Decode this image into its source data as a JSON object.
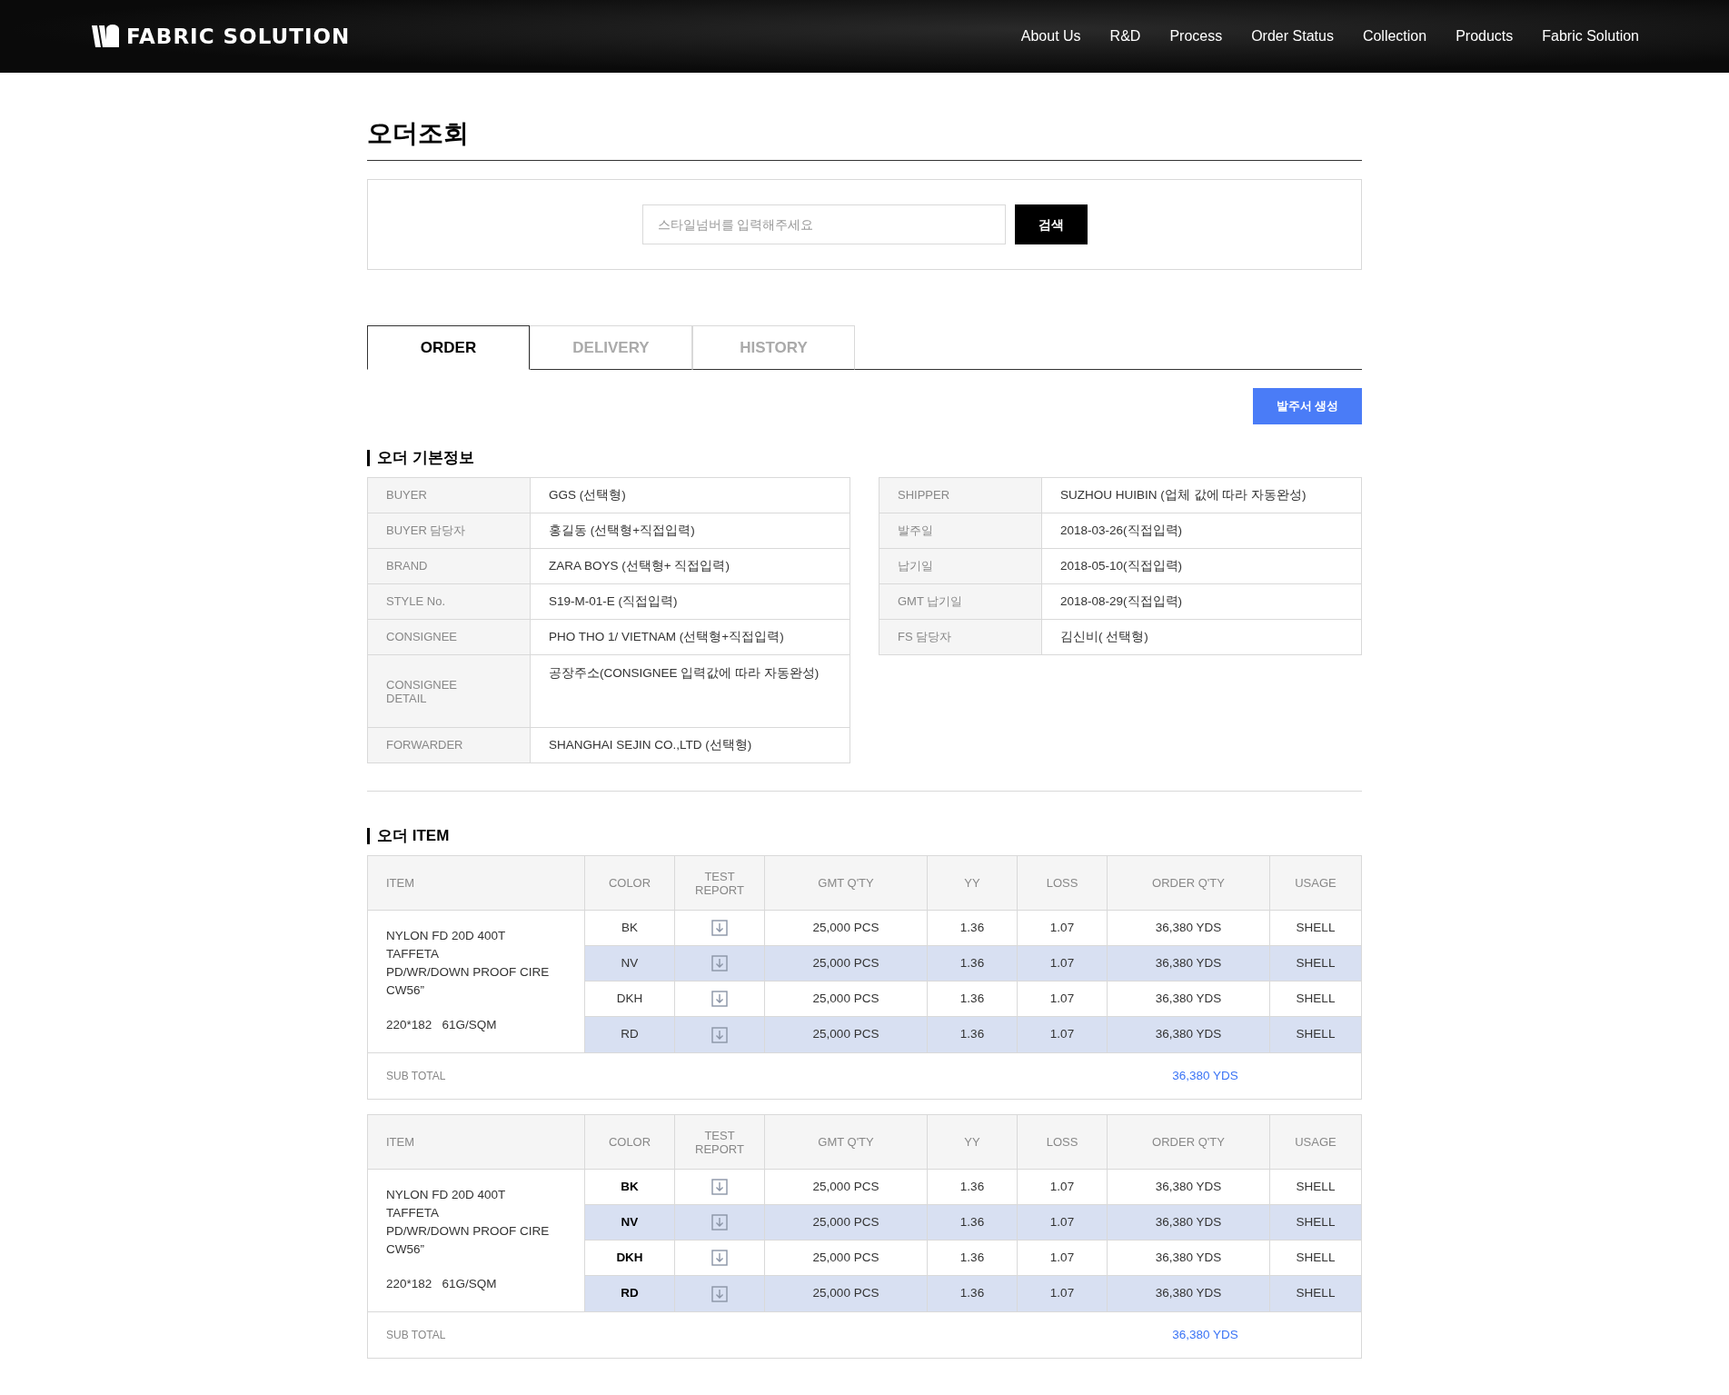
{
  "header": {
    "logo": "FABRIC SOLUTION",
    "nav": [
      "About Us",
      "R&D",
      "Process",
      "Order Status",
      "Collection",
      "Products",
      "Fabric Solution"
    ]
  },
  "page_title": "오더조회",
  "search": {
    "placeholder": "스타일넘버를 입력해주세요",
    "button": "검색"
  },
  "tabs": [
    {
      "label": "ORDER",
      "selected": true
    },
    {
      "label": "DELIVERY",
      "selected": false
    },
    {
      "label": "HISTORY",
      "selected": false
    }
  ],
  "create_button": "발주서 생성",
  "basic_info": {
    "title": "오더 기본정보",
    "left": [
      {
        "label": "BUYER",
        "value": "GGS (선택형)"
      },
      {
        "label": "BUYER 담당자",
        "value": "홍길동 (선택형+직접입력)"
      },
      {
        "label": "BRAND",
        "value": "ZARA BOYS (선택형+ 직접입력)"
      },
      {
        "label": "STYLE No.",
        "value": "S19-M-01-E (직접입력)"
      },
      {
        "label": "CONSIGNEE",
        "value": "PHO THO 1/ VIETNAM (선택형+직접입력)"
      },
      {
        "label": "CONSIGNEE DETAIL",
        "value": "공장주소(CONSIGNEE 입력값에 따라 자동완성)",
        "kind": "tall"
      },
      {
        "label": "FORWARDER",
        "value": "SHANGHAI SEJIN CO.,LTD (선택형)"
      }
    ],
    "right": [
      {
        "label": "SHIPPER",
        "value": "SUZHOU HUIBIN (업체 값에 따라 자동완성)"
      },
      {
        "label": "발주일",
        "value": "2018-03-26(직접입력)"
      },
      {
        "label": "납기일",
        "value": "2018-05-10(직접입력)"
      },
      {
        "label": "GMT 납기일",
        "value": "2018-08-29(직접입력)"
      },
      {
        "label": "FS 담당자",
        "value": "김신비( 선택형)"
      }
    ]
  },
  "items": {
    "title": "오더 ITEM",
    "tables": [
      {
        "columns": [
          "ITEM",
          "COLOR",
          "TEST REPORT",
          "GMT Q'TY",
          "YY",
          "LOSS",
          "ORDER Q'TY",
          "USAGE"
        ],
        "color_bold": false,
        "item_lines": [
          "NYLON FD 20D 400T",
          "TAFFETA",
          "PD/WR/DOWN PROOF CIRE",
          "CW56”"
        ],
        "item_spec": "220*182   61G/SQM",
        "rows": [
          {
            "color_code": "BK",
            "gmt": "25,000 PCS",
            "yy": "1.36",
            "loss": "1.07",
            "order": "36,380 YDS",
            "usage": "SHELL",
            "highlighted": false
          },
          {
            "color_code": "NV",
            "gmt": "25,000 PCS",
            "yy": "1.36",
            "loss": "1.07",
            "order": "36,380 YDS",
            "usage": "SHELL",
            "highlighted": true
          },
          {
            "color_code": "DKH",
            "gmt": "25,000 PCS",
            "yy": "1.36",
            "loss": "1.07",
            "order": "36,380 YDS",
            "usage": "SHELL",
            "highlighted": false
          },
          {
            "color_code": "RD",
            "gmt": "25,000 PCS",
            "yy": "1.36",
            "loss": "1.07",
            "order": "36,380 YDS",
            "usage": "SHELL",
            "highlighted": true
          }
        ],
        "subtotal_label": "SUB TOTAL",
        "subtotal": "36,380 YDS"
      },
      {
        "columns": [
          "ITEM",
          "COLOR",
          "TEST REPORT",
          "GMT Q'TY",
          "YY",
          "LOSS",
          "ORDER Q'TY",
          "USAGE"
        ],
        "color_bold": true,
        "item_lines": [
          "NYLON FD 20D 400T",
          "TAFFETA",
          "PD/WR/DOWN PROOF CIRE",
          "CW56”"
        ],
        "item_spec": "220*182   61G/SQM",
        "rows": [
          {
            "color_code": "BK",
            "gmt": "25,000 PCS",
            "yy": "1.36",
            "loss": "1.07",
            "order": "36,380 YDS",
            "usage": "SHELL",
            "highlighted": false
          },
          {
            "color_code": "NV",
            "gmt": "25,000 PCS",
            "yy": "1.36",
            "loss": "1.07",
            "order": "36,380 YDS",
            "usage": "SHELL",
            "highlighted": true
          },
          {
            "color_code": "DKH",
            "gmt": "25,000 PCS",
            "yy": "1.36",
            "loss": "1.07",
            "order": "36,380 YDS",
            "usage": "SHELL",
            "highlighted": false
          },
          {
            "color_code": "RD",
            "gmt": "25,000 PCS",
            "yy": "1.36",
            "loss": "1.07",
            "order": "36,380 YDS",
            "usage": "SHELL",
            "highlighted": true
          }
        ],
        "subtotal_label": "SUB TOTAL",
        "subtotal": "36,380 YDS"
      }
    ]
  }
}
